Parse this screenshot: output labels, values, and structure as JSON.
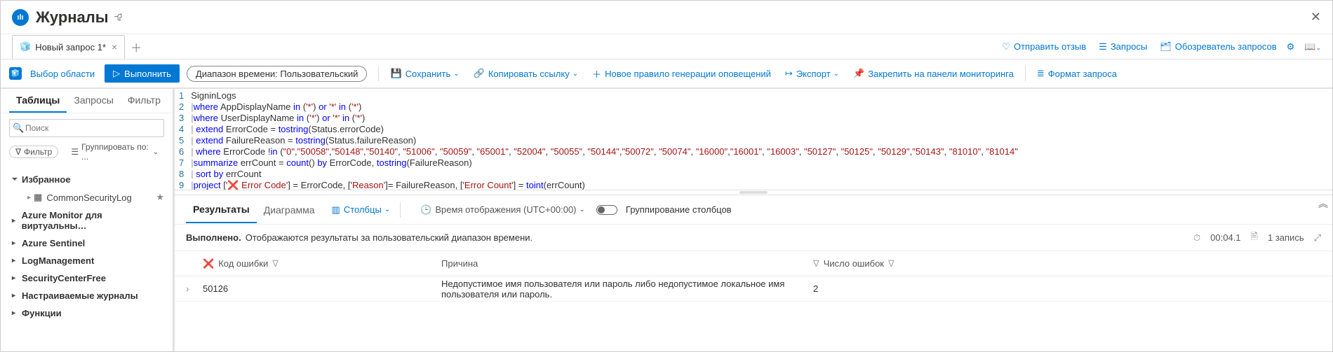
{
  "header": {
    "title": "Журналы"
  },
  "tabs": {
    "active_label": "Новый запрос 1*"
  },
  "top_links": {
    "feedback": "Отправить отзыв",
    "queries": "Запросы",
    "query_explorer": "Обозреватель запросов"
  },
  "toolbar": {
    "scope": "Выбор области",
    "run": "Выполнить",
    "time_range": "Диапазон времени: Пользовательский",
    "save": "Сохранить",
    "copy_link": "Копировать ссылку",
    "new_alert": "Новое правило генерации оповещений",
    "export": "Экспорт",
    "pin": "Закрепить на панели мониторинга",
    "format": "Формат запроса"
  },
  "sidebar": {
    "tabs": {
      "tables": "Таблицы",
      "queries": "Запросы",
      "filter": "Фильтр"
    },
    "search_placeholder": "Поиск",
    "filter_chip": "Фильтр",
    "group_chip": "Группировать по: ...",
    "groups": [
      {
        "label": "Избранное",
        "expanded": true,
        "items": [
          "CommonSecurityLog"
        ]
      },
      {
        "label": "Azure Monitor для виртуальны…",
        "expanded": false
      },
      {
        "label": "Azure Sentinel",
        "expanded": false
      },
      {
        "label": "LogManagement",
        "expanded": false
      },
      {
        "label": "SecurityCenterFree",
        "expanded": false
      },
      {
        "label": "Настраиваемые журналы",
        "expanded": false
      },
      {
        "label": "Функции",
        "expanded": false
      }
    ]
  },
  "query_lines": [
    [
      {
        "t": "plain",
        "v": "SigninLogs"
      }
    ],
    [
      {
        "t": "op",
        "v": "|"
      },
      {
        "t": "kw",
        "v": "where"
      },
      {
        "t": "plain",
        "v": " AppDisplayName "
      },
      {
        "t": "kw",
        "v": "in"
      },
      {
        "t": "plain",
        "v": " ("
      },
      {
        "t": "str",
        "v": "'*'"
      },
      {
        "t": "plain",
        "v": ") "
      },
      {
        "t": "kw",
        "v": "or"
      },
      {
        "t": "plain",
        "v": " "
      },
      {
        "t": "str",
        "v": "'*'"
      },
      {
        "t": "plain",
        "v": " "
      },
      {
        "t": "kw",
        "v": "in"
      },
      {
        "t": "plain",
        "v": " ("
      },
      {
        "t": "str",
        "v": "'*'"
      },
      {
        "t": "plain",
        "v": ")"
      }
    ],
    [
      {
        "t": "op",
        "v": "|"
      },
      {
        "t": "kw",
        "v": "where"
      },
      {
        "t": "plain",
        "v": " UserDisplayName "
      },
      {
        "t": "kw",
        "v": "in"
      },
      {
        "t": "plain",
        "v": " ("
      },
      {
        "t": "str",
        "v": "'*'"
      },
      {
        "t": "plain",
        "v": ") "
      },
      {
        "t": "kw",
        "v": "or"
      },
      {
        "t": "plain",
        "v": " "
      },
      {
        "t": "str",
        "v": "'*'"
      },
      {
        "t": "plain",
        "v": " "
      },
      {
        "t": "kw",
        "v": "in"
      },
      {
        "t": "plain",
        "v": " ("
      },
      {
        "t": "str",
        "v": "'*'"
      },
      {
        "t": "plain",
        "v": ")"
      }
    ],
    [
      {
        "t": "op",
        "v": "| "
      },
      {
        "t": "kw",
        "v": "extend"
      },
      {
        "t": "plain",
        "v": " ErrorCode = "
      },
      {
        "t": "fn",
        "v": "tostring"
      },
      {
        "t": "plain",
        "v": "(Status.errorCode)"
      }
    ],
    [
      {
        "t": "op",
        "v": "| "
      },
      {
        "t": "kw",
        "v": "extend"
      },
      {
        "t": "plain",
        "v": " FailureReason = "
      },
      {
        "t": "fn",
        "v": "tostring"
      },
      {
        "t": "plain",
        "v": "(Status.failureReason)"
      }
    ],
    [
      {
        "t": "op",
        "v": "| "
      },
      {
        "t": "kw",
        "v": "where"
      },
      {
        "t": "plain",
        "v": " ErrorCode !"
      },
      {
        "t": "kw",
        "v": "in"
      },
      {
        "t": "plain",
        "v": " ("
      },
      {
        "t": "str",
        "v": "\"0\""
      },
      {
        "t": "plain",
        "v": ","
      },
      {
        "t": "str",
        "v": "\"50058\""
      },
      {
        "t": "plain",
        "v": ","
      },
      {
        "t": "str",
        "v": "\"50148\""
      },
      {
        "t": "plain",
        "v": ","
      },
      {
        "t": "str",
        "v": "\"50140\""
      },
      {
        "t": "plain",
        "v": ", "
      },
      {
        "t": "str",
        "v": "\"51006\""
      },
      {
        "t": "plain",
        "v": ", "
      },
      {
        "t": "str",
        "v": "\"50059\""
      },
      {
        "t": "plain",
        "v": ", "
      },
      {
        "t": "str",
        "v": "\"65001\""
      },
      {
        "t": "plain",
        "v": ", "
      },
      {
        "t": "str",
        "v": "\"52004\""
      },
      {
        "t": "plain",
        "v": ", "
      },
      {
        "t": "str",
        "v": "\"50055\""
      },
      {
        "t": "plain",
        "v": ", "
      },
      {
        "t": "str",
        "v": "\"50144\""
      },
      {
        "t": "plain",
        "v": ","
      },
      {
        "t": "str",
        "v": "\"50072\""
      },
      {
        "t": "plain",
        "v": ", "
      },
      {
        "t": "str",
        "v": "\"50074\""
      },
      {
        "t": "plain",
        "v": ", "
      },
      {
        "t": "str",
        "v": "\"16000\""
      },
      {
        "t": "plain",
        "v": ","
      },
      {
        "t": "str",
        "v": "\"16001\""
      },
      {
        "t": "plain",
        "v": ", "
      },
      {
        "t": "str",
        "v": "\"16003\""
      },
      {
        "t": "plain",
        "v": ", "
      },
      {
        "t": "str",
        "v": "\"50127\""
      },
      {
        "t": "plain",
        "v": ", "
      },
      {
        "t": "str",
        "v": "\"50125\""
      },
      {
        "t": "plain",
        "v": ", "
      },
      {
        "t": "str",
        "v": "\"50129\""
      },
      {
        "t": "plain",
        "v": ","
      },
      {
        "t": "str",
        "v": "\"50143\""
      },
      {
        "t": "plain",
        "v": ", "
      },
      {
        "t": "str",
        "v": "\"81010\""
      },
      {
        "t": "plain",
        "v": ", "
      },
      {
        "t": "str",
        "v": "\"81014\""
      }
    ],
    [
      {
        "t": "op",
        "v": "|"
      },
      {
        "t": "kw",
        "v": "summarize"
      },
      {
        "t": "plain",
        "v": " errCount = "
      },
      {
        "t": "fn",
        "v": "count"
      },
      {
        "t": "plain",
        "v": "() "
      },
      {
        "t": "kw",
        "v": "by"
      },
      {
        "t": "plain",
        "v": " ErrorCode, "
      },
      {
        "t": "fn",
        "v": "tostring"
      },
      {
        "t": "plain",
        "v": "(FailureReason)"
      }
    ],
    [
      {
        "t": "op",
        "v": "| "
      },
      {
        "t": "kw",
        "v": "sort by"
      },
      {
        "t": "plain",
        "v": " errCount"
      }
    ],
    [
      {
        "t": "op",
        "v": "|"
      },
      {
        "t": "kw",
        "v": "project"
      },
      {
        "t": "plain",
        "v": " ["
      },
      {
        "t": "str",
        "v": "'"
      },
      {
        "t": "redx",
        "v": "❌"
      },
      {
        "t": "str",
        "v": " Error Code'"
      },
      {
        "t": "plain",
        "v": "] = ErrorCode, ["
      },
      {
        "t": "str",
        "v": "'Reason'"
      },
      {
        "t": "plain",
        "v": "]= FailureReason, ["
      },
      {
        "t": "str",
        "v": "'Error Count'"
      },
      {
        "t": "plain",
        "v": "] = "
      },
      {
        "t": "fn",
        "v": "toint"
      },
      {
        "t": "plain",
        "v": "(errCount)"
      }
    ]
  ],
  "results": {
    "tabs": {
      "results": "Результаты",
      "chart": "Диаграмма"
    },
    "columns_btn": "Столбцы",
    "display_time": "Время отображения (UTC+00:00)",
    "group_cols": "Группирование столбцов",
    "status_strong": "Выполнено.",
    "status_text": "Отображаются результаты за пользовательский диапазон времени.",
    "elapsed": "00:04.1",
    "records": "1 запись",
    "headers": {
      "error_code": "Код ошибки",
      "reason": "Причина",
      "error_count": "Число ошибок"
    },
    "rows": [
      {
        "code": "50126",
        "reason": "Недопустимое имя пользователя или пароль либо недопустимое локальное имя пользователя или пароль.",
        "count": "2"
      }
    ]
  }
}
